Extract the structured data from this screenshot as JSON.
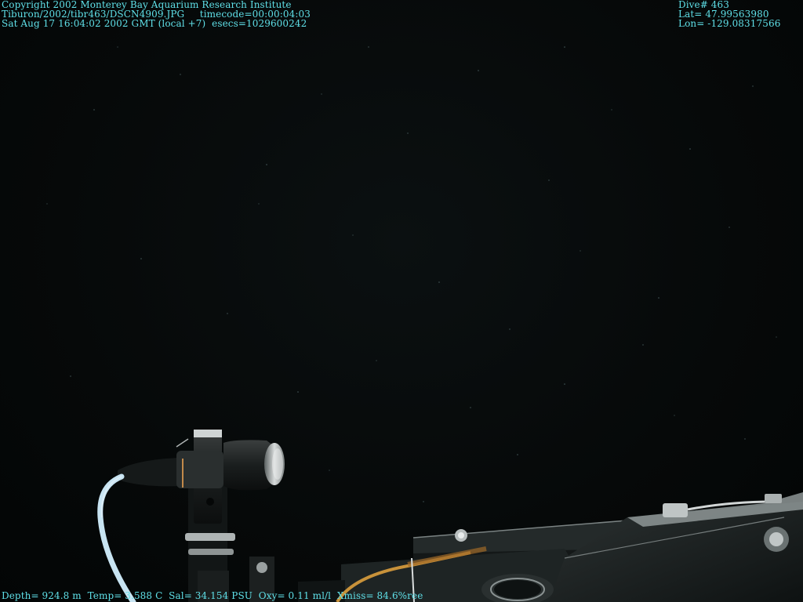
{
  "overlay": {
    "top_left": [
      "Copyright 2002 Monterey Bay Aquarium Research Institute",
      "Tiburon/2002/tibr463/DSCN4909.JPG     timecode=00:00:04:03",
      "Sat Aug 17 16:04:02 2002 GMT (local +7)  esecs=1029600242"
    ],
    "top_right": [
      "Dive# 463",
      "Lat= 47.99563980",
      "Lon= -129.08317566"
    ],
    "bottom": "Depth= 924.8 m  Temp= 3.588 C  Sal= 34.154 PSU  Oxy= 0.11 ml/l  Xmiss= 84.6%ree"
  },
  "colors": {
    "overlay_text": "#5fe0e8",
    "background": "#060909",
    "cable": "#c8e4f2"
  }
}
